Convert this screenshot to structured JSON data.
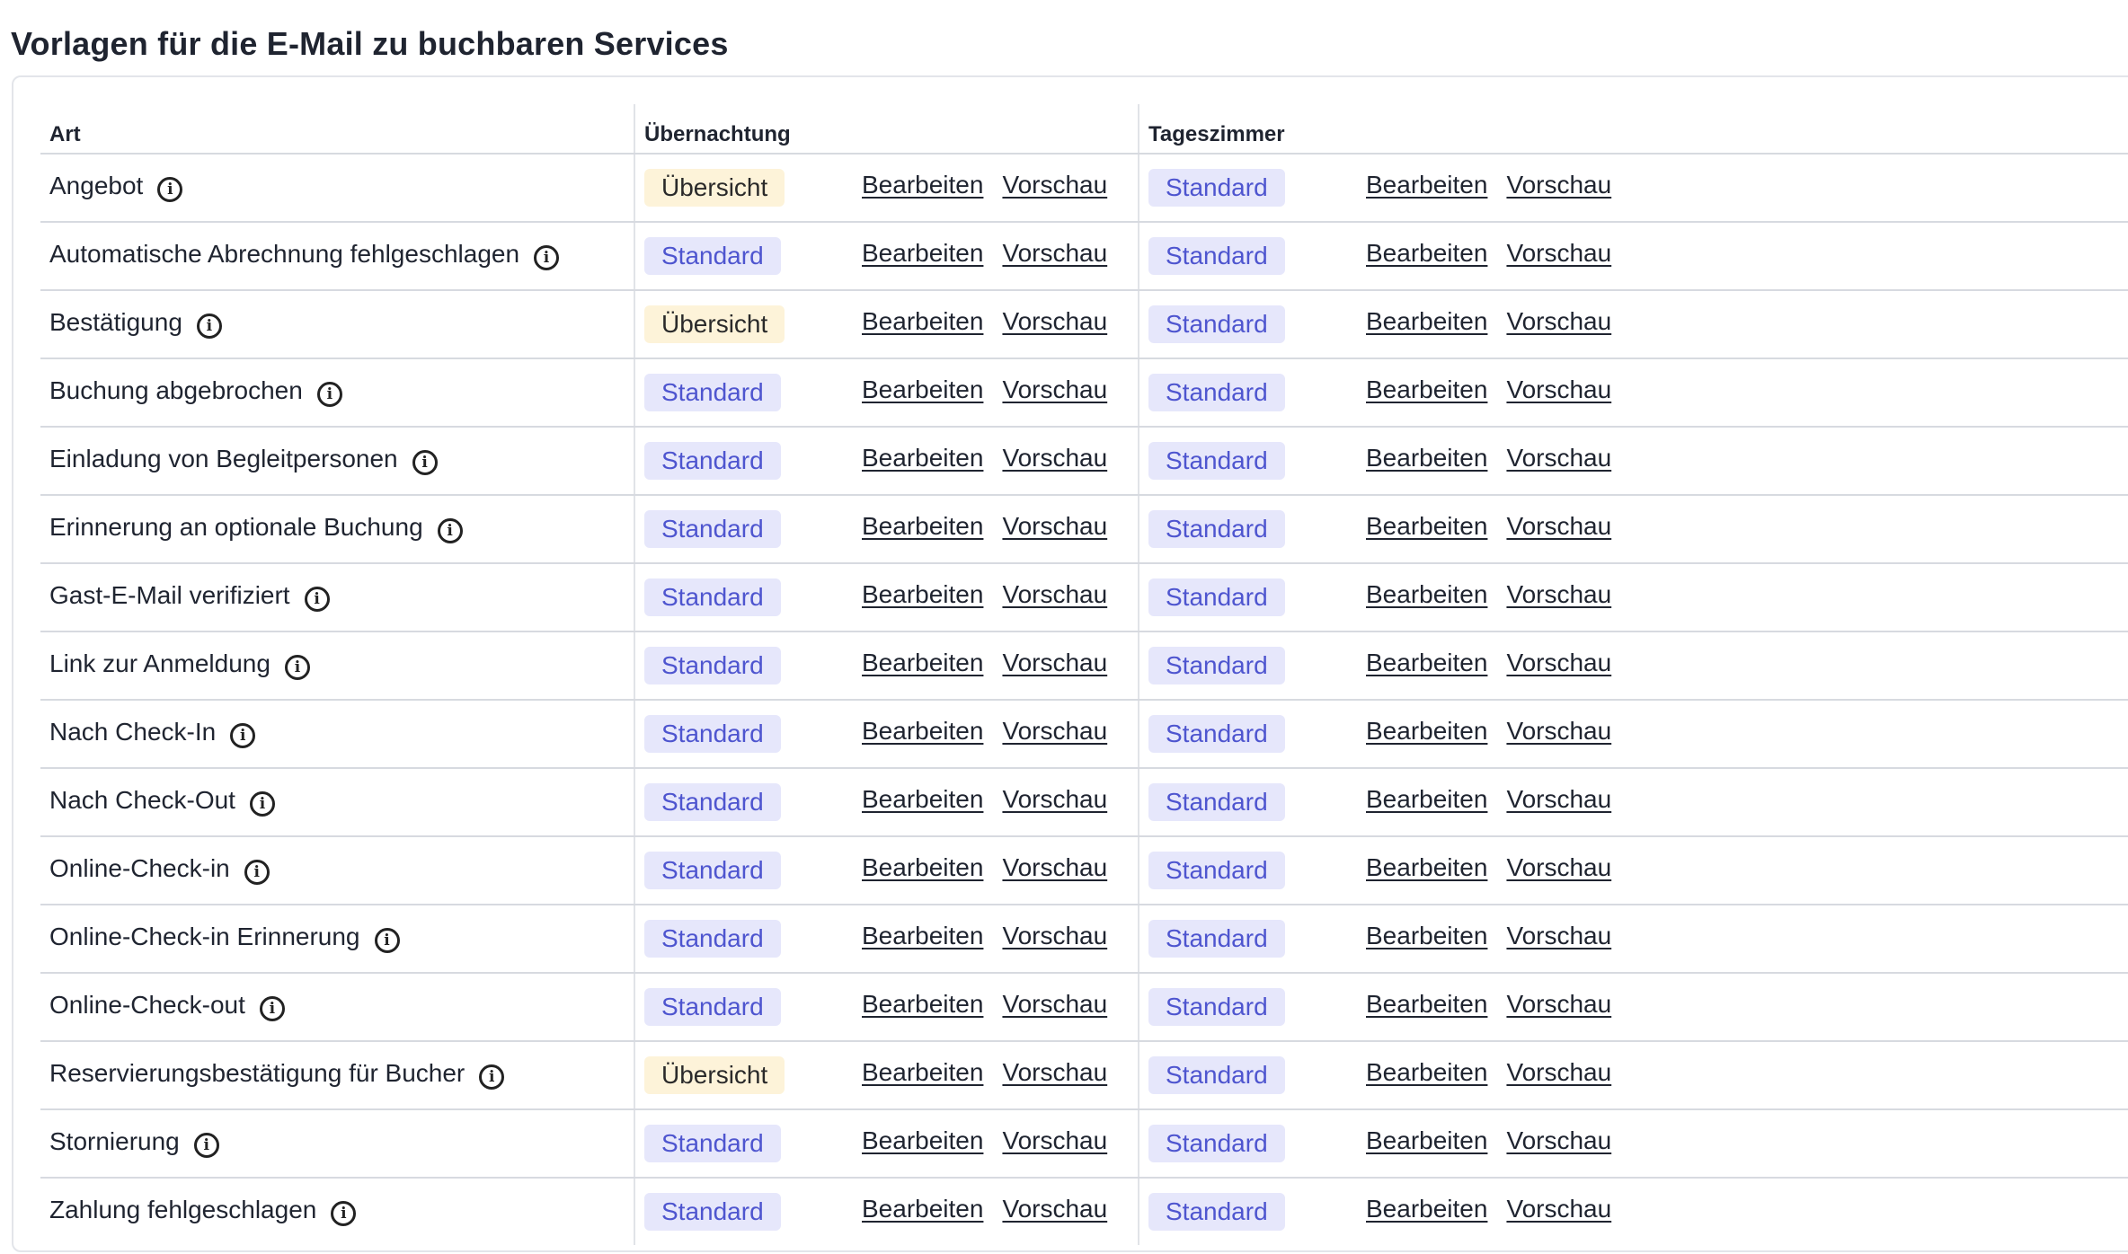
{
  "page": {
    "title": "Vorlagen für die E-Mail zu buchbaren Services"
  },
  "table": {
    "headers": {
      "art": "Art",
      "uebernachtung": "Übernachtung",
      "tageszimmer": "Tageszimmer"
    },
    "link_edit": "Bearbeiten",
    "link_preview": "Vorschau",
    "info_glyph": "i",
    "rows": [
      {
        "art": "Angebot",
        "uebernachtung": "Übersicht",
        "tageszimmer": "Standard"
      },
      {
        "art": "Automatische Abrechnung fehlgeschlagen",
        "uebernachtung": "Standard",
        "tageszimmer": "Standard"
      },
      {
        "art": "Bestätigung",
        "uebernachtung": "Übersicht",
        "tageszimmer": "Standard"
      },
      {
        "art": "Buchung abgebrochen",
        "uebernachtung": "Standard",
        "tageszimmer": "Standard"
      },
      {
        "art": "Einladung von Begleitpersonen",
        "uebernachtung": "Standard",
        "tageszimmer": "Standard"
      },
      {
        "art": "Erinnerung an optionale Buchung",
        "uebernachtung": "Standard",
        "tageszimmer": "Standard"
      },
      {
        "art": "Gast-E-Mail verifiziert",
        "uebernachtung": "Standard",
        "tageszimmer": "Standard"
      },
      {
        "art": "Link zur Anmeldung",
        "uebernachtung": "Standard",
        "tageszimmer": "Standard"
      },
      {
        "art": "Nach Check-In",
        "uebernachtung": "Standard",
        "tageszimmer": "Standard"
      },
      {
        "art": "Nach Check-Out",
        "uebernachtung": "Standard",
        "tageszimmer": "Standard"
      },
      {
        "art": "Online-Check-in",
        "uebernachtung": "Standard",
        "tageszimmer": "Standard"
      },
      {
        "art": "Online-Check-in Erinnerung",
        "uebernachtung": "Standard",
        "tageszimmer": "Standard"
      },
      {
        "art": "Online-Check-out",
        "uebernachtung": "Standard",
        "tageszimmer": "Standard"
      },
      {
        "art": "Reservierungsbestätigung für Bucher",
        "uebernachtung": "Übersicht",
        "tageszimmer": "Standard"
      },
      {
        "art": "Stornierung",
        "uebernachtung": "Standard",
        "tageszimmer": "Standard"
      },
      {
        "art": "Zahlung fehlgeschlagen",
        "uebernachtung": "Standard",
        "tageszimmer": "Standard"
      }
    ]
  },
  "colors": {
    "standard_badge_bg": "#e6e7fb",
    "standard_badge_text": "#4e55cf",
    "uebersicht_badge_bg": "#fdf3d9",
    "uebersicht_badge_text": "#2a2a2a"
  },
  "icons": {
    "info": "info-circle-icon"
  }
}
